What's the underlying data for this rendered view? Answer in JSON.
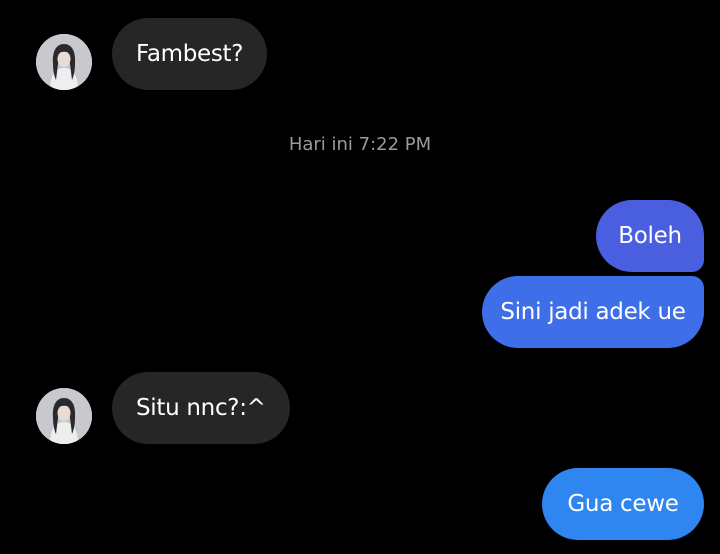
{
  "messages": [
    {
      "id": "m1",
      "direction": "incoming",
      "text": "Fambest?"
    },
    {
      "id": "m2",
      "direction": "outgoing",
      "text": "Boleh",
      "color": "#4a5ee0"
    },
    {
      "id": "m3",
      "direction": "outgoing",
      "text": "Sini jadi adek ue",
      "color": "#3f6fe8"
    },
    {
      "id": "m4",
      "direction": "incoming",
      "text": "Situ nnc?:^"
    },
    {
      "id": "m5",
      "direction": "outgoing",
      "text": "Gua cewe",
      "color": "#2f86f0"
    }
  ],
  "timestamp": "Hari ini 7:22 PM",
  "colors": {
    "background": "#000000",
    "incoming_bubble": "#262626",
    "timestamp_text": "#9a9a9a"
  }
}
